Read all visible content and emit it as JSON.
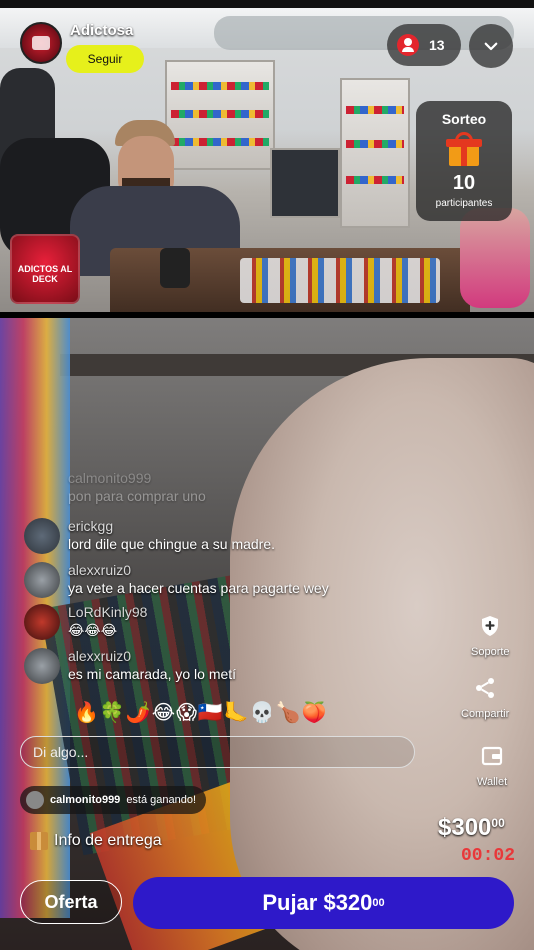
{
  "streamer": {
    "name": "Adictosa",
    "follow_label": "Seguir",
    "logo_text": "ADICTOS AL DECK"
  },
  "header": {
    "viewer_count": "13"
  },
  "giveaway": {
    "title": "Sorteo",
    "count": "10",
    "label": "participantes"
  },
  "chat": {
    "messages": [
      {
        "user": "calmonito999",
        "text": "pon para comprar uno",
        "faded": true
      },
      {
        "user": "erickgg",
        "text": "lord dile que chingue a su madre.",
        "faded": false
      },
      {
        "user": "alexxruiz0",
        "text": "ya vete a hacer cuentas para pagarte wey",
        "faded": false
      },
      {
        "user": "LoRdKinly98",
        "text": "😂😂😂",
        "faded": false
      },
      {
        "user": "alexxruiz0",
        "text": "es mi camarada, yo lo metí",
        "faded": false
      }
    ],
    "emoji_reactions": "🔥🍀🌶️😂😱🇨🇱🦶💀🍗🍑",
    "input_placeholder": "Di algo..."
  },
  "winning": {
    "user": "calmonito999",
    "text": "está ganando!"
  },
  "delivery_label": "Info de entrega",
  "side_actions": {
    "support": "Soporte",
    "share": "Compartir",
    "wallet": "Wallet"
  },
  "auction": {
    "price_main": "$300",
    "price_cents": "00",
    "timer": "00:02",
    "offer_label": "Oferta",
    "bid_main": "Pujar $320",
    "bid_cents": "00"
  },
  "colors": {
    "accent_yellow": "#e6f01b",
    "bid_blue": "#2e19c9",
    "timer_red": "#e8383a",
    "viewer_red": "#e3262d"
  }
}
